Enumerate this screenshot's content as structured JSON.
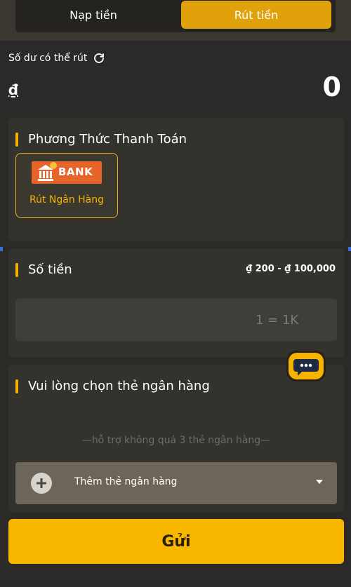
{
  "tabs": [
    {
      "label": "Nạp tiền",
      "active": false
    },
    {
      "label": "Rút tiền",
      "active": true
    }
  ],
  "balance": {
    "label": "Số dư có thể rút",
    "currency_symbol": "₫",
    "value": "0"
  },
  "payment_method": {
    "title": "Phương Thức Thanh Toán",
    "option": {
      "logo_text": "BANK",
      "label": "Rút Ngân Hàng",
      "selected": true
    }
  },
  "amount": {
    "title": "Số tiền",
    "range": "₫ 200 - ₫ 100,000",
    "placeholder": "1 = 1K"
  },
  "bank_card": {
    "title": "Vui lòng chọn thẻ ngân hàng",
    "hint": "—hỗ trợ không quá 3 thẻ ngân hàng—",
    "add_label": "Thêm thẻ ngân hàng"
  },
  "submit": {
    "label": "Gửi"
  },
  "colors": {
    "background": "#2b2a28",
    "card": "#34322d",
    "accent": "#f9b700",
    "tab_active": "#e0a10a",
    "bank_logo": "#e8642a"
  },
  "icons": [
    "refresh-icon",
    "bank-icon",
    "chat-icon",
    "plus-icon",
    "chevron-down-icon"
  ]
}
